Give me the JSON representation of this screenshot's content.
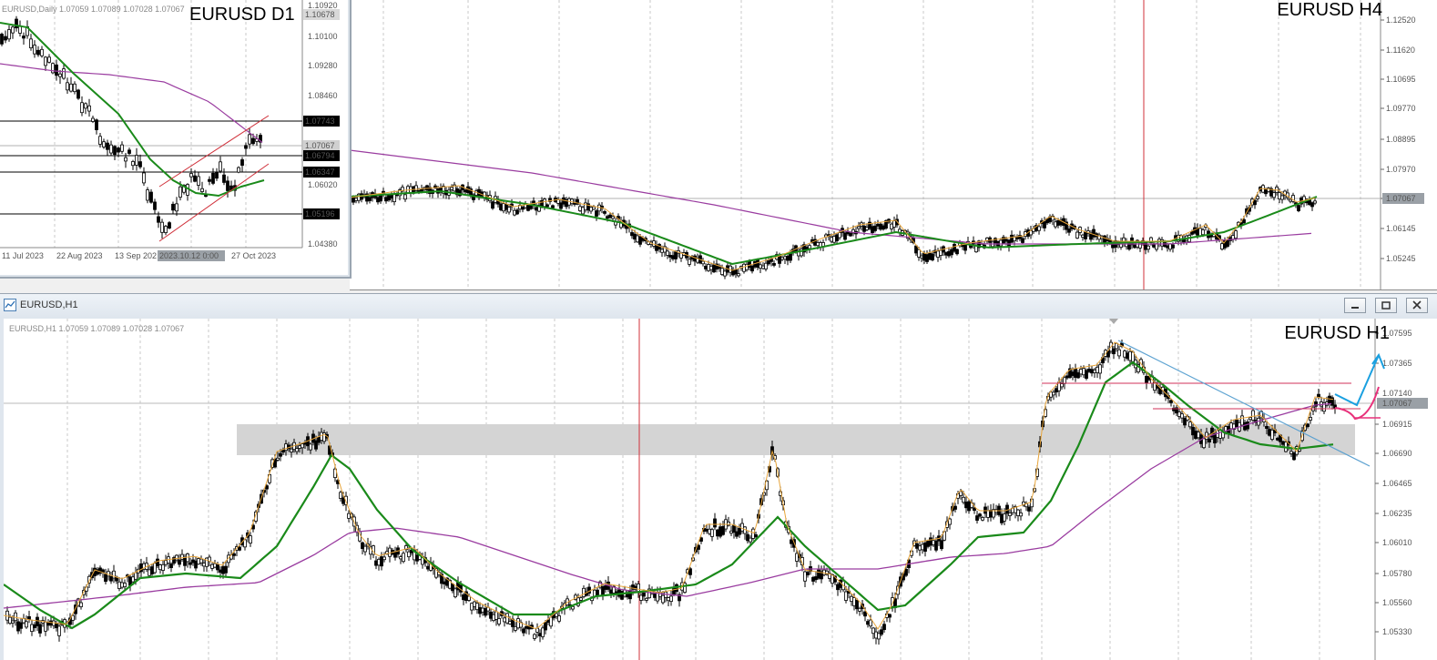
{
  "h4": {
    "symbol_label": "EURUSD H4",
    "price_ticks": [
      "1.12520",
      "1.11620",
      "1.10695",
      "1.09770",
      "1.08895",
      "1.07970",
      "1.07067",
      "1.06145",
      "1.05245"
    ],
    "current_price": "1.07067"
  },
  "d1": {
    "symbol_label": "EURUSD D1",
    "info_line": "EURUSD,Daily  1.07059 1.07089 1.07028 1.07067",
    "price_ticks": [
      "1.10920",
      "1.10678",
      "1.10100",
      "1.09280",
      "1.08460",
      "1.07743",
      "1.07067",
      "1.06794",
      "1.06347",
      "1.06020",
      "1.05196",
      "1.04380"
    ],
    "date_ticks": [
      "11 Jul 2023",
      "22 Aug 2023",
      "13 Sep 202",
      "2023.10.12 0:00",
      "27 Oct 2023"
    ],
    "level_labels": [
      "1.07743",
      "1.06794",
      "1.06347",
      "1.05196"
    ],
    "current_price": "1.07067"
  },
  "h1": {
    "window_title": "EURUSD,H1",
    "symbol_label": "EURUSD H1",
    "info_line": "EURUSD,H1  1.07059 1.07089 1.07028 1.07067",
    "price_ticks": [
      "1.07595",
      "1.07365",
      "1.07140",
      "1.06915",
      "1.06690",
      "1.06465",
      "1.06235",
      "1.06010",
      "1.05780",
      "1.05560",
      "1.05330"
    ],
    "current_price": "1.07067"
  },
  "colors": {
    "ma_fast": "#e8a53a",
    "ma_mid": "#1a8a1a",
    "ma_slow": "#9a3ca0",
    "vline": "#d0303a",
    "trend": "#5aa0d0",
    "arrow_up": "#1aa0e0",
    "arrow_down": "#e8307a",
    "zone": "#d4d4d4"
  },
  "icons": [
    "chart-window-icon",
    "minimize-icon",
    "restore-icon",
    "close-icon"
  ]
}
